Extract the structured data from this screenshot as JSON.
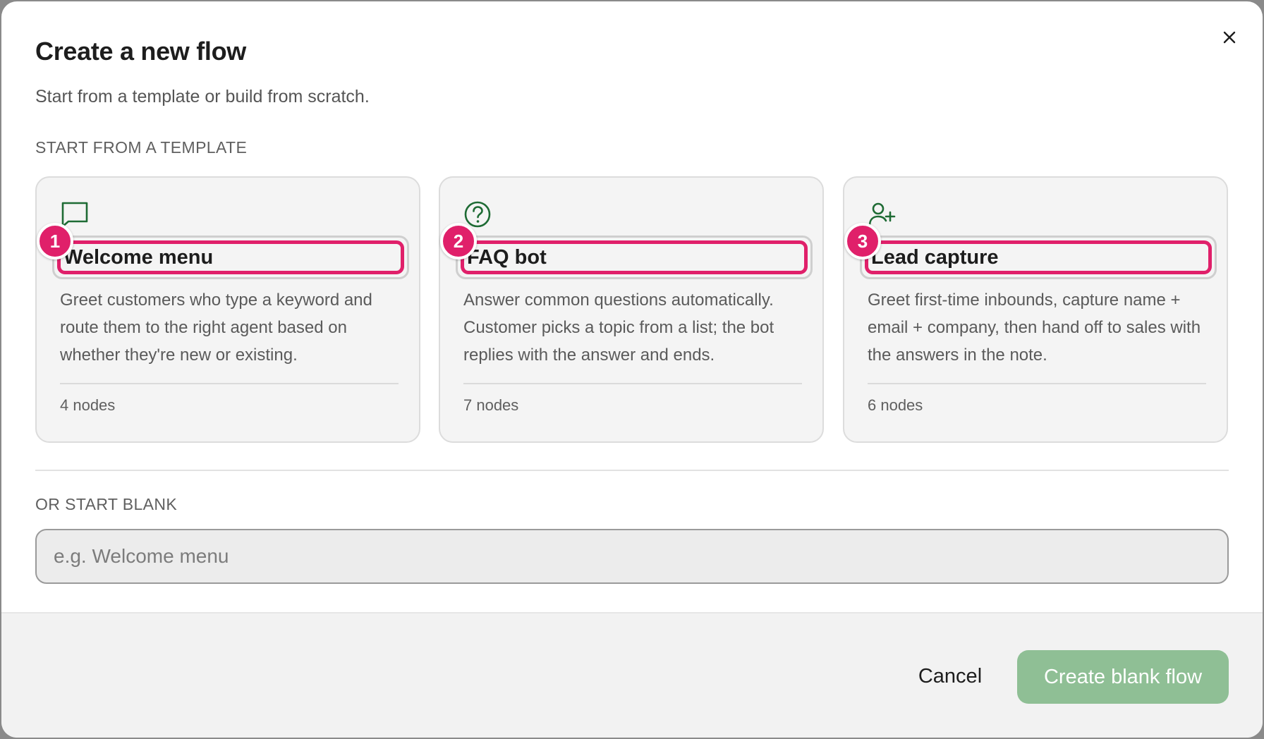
{
  "dialog": {
    "title": "Create a new flow",
    "subtitle": "Start from a template or build from scratch.",
    "close_icon": "close-icon"
  },
  "templates_section": {
    "label": "START FROM A TEMPLATE",
    "cards": [
      {
        "badge": "1",
        "icon": "chat-bubble-icon",
        "name": "Welcome menu",
        "description": "Greet customers who type a keyword and route them to the right agent based on whether they're new or existing.",
        "nodes": "4 nodes"
      },
      {
        "badge": "2",
        "icon": "question-circle-icon",
        "name": "FAQ bot",
        "description": "Answer common questions automatically. Customer picks a topic from a list; the bot replies with the answer and ends.",
        "nodes": "7 nodes"
      },
      {
        "badge": "3",
        "icon": "user-plus-icon",
        "name": "Lead capture",
        "description": "Greet first-time inbounds, capture name + email + company, then hand off to sales with the answers in the note.",
        "nodes": "6 nodes"
      }
    ]
  },
  "blank_section": {
    "label": "OR START BLANK",
    "input_placeholder": "e.g. Welcome menu",
    "input_value": ""
  },
  "footer": {
    "cancel_label": "Cancel",
    "create_label": "Create blank flow"
  },
  "colors": {
    "accent_green": "#1e6b34",
    "highlight_pink": "#e0206a",
    "primary_button_disabled": "#8fbf95"
  }
}
